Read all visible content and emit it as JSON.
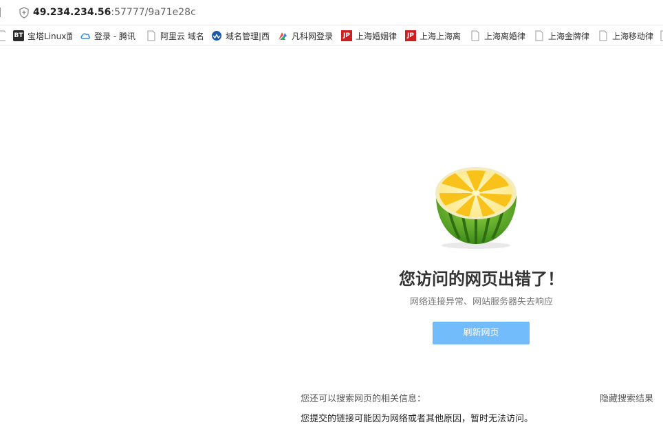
{
  "address_bar": {
    "url_host": "49.234.234.56",
    "url_rest": ":57777/9a71e28c"
  },
  "bookmarks": [
    {
      "icon": "bt-panel-icon",
      "label": "宝塔Linux面"
    },
    {
      "icon": "cloud-icon",
      "label": "登录 - 腾讯"
    },
    {
      "icon": "page-icon",
      "label": "阿里云 域名"
    },
    {
      "icon": "globe-icon",
      "label": "域名管理|西"
    },
    {
      "icon": "fanke-icon",
      "label": "凡科网登录"
    },
    {
      "icon": "jp-icon",
      "label": "上海婚姻律"
    },
    {
      "icon": "jp-icon",
      "label": "上海上海离"
    },
    {
      "icon": "page-icon",
      "label": "上海离婚律"
    },
    {
      "icon": "page-icon",
      "label": "上海金牌律"
    },
    {
      "icon": "page-icon",
      "label": "上海移动律"
    }
  ],
  "error": {
    "title": "您访问的网页出错了！",
    "subtitle": "网络连接异常、网站服务器失去响应",
    "refresh_label": "刷新网页"
  },
  "search": {
    "prompt": "您还可以搜索网页的相关信息：",
    "hide_label": "隐藏搜索结果",
    "reason": "您提交的链接可能因为网络或者其他原因，暂时无法访问。"
  },
  "colors": {
    "button_bg": "#73bcfb",
    "fruit_yellow": "#f8c21a",
    "rind_green": "#5aa524"
  }
}
